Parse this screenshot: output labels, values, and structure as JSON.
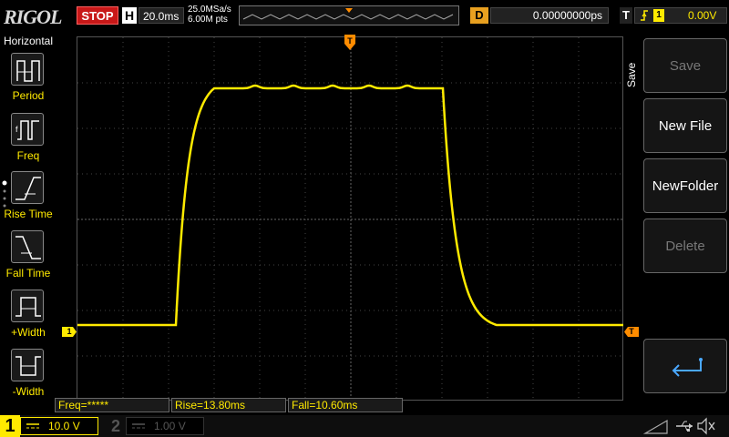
{
  "header": {
    "brand": "RIGOL",
    "run_state": "STOP",
    "horizontal_label": "H",
    "timebase": "20.0ms",
    "sample_rate": "25.0MSa/s",
    "memory_depth": "6.00M pts",
    "delay_label": "D",
    "delay_value": "0.00000000ps",
    "trigger_label": "T",
    "trigger_source": "1",
    "trigger_level": "0.00V"
  },
  "left_menu": {
    "title": "Horizontal",
    "items": [
      {
        "label": "Period",
        "icon": "period-icon"
      },
      {
        "label": "Freq",
        "icon": "freq-icon"
      },
      {
        "label": "Rise Time",
        "icon": "rise-time-icon"
      },
      {
        "label": "Fall Time",
        "icon": "fall-time-icon"
      },
      {
        "label": "+Width",
        "icon": "pos-width-icon"
      },
      {
        "label": "-Width",
        "icon": "neg-width-icon"
      }
    ]
  },
  "right_menu": {
    "title": "Save",
    "buttons": [
      {
        "label": "Save",
        "enabled": false
      },
      {
        "label": "New File",
        "enabled": true
      },
      {
        "label": "NewFolder",
        "enabled": true
      },
      {
        "label": "Delete",
        "enabled": false
      }
    ],
    "back_icon": "return-arrow-icon"
  },
  "measurements": {
    "freq": "Freq=*****",
    "rise": "Rise=13.80ms",
    "fall": "Fall=10.60ms"
  },
  "channels": {
    "ch1_num": "1",
    "ch1_scale": "10.0 V",
    "ch2_num": "2",
    "ch2_scale": "1.00 V"
  },
  "markers": {
    "ch1_ground": "1",
    "trigger_pos": "T"
  },
  "colors": {
    "ch1": "#ffea00",
    "trigger": "#ff8c00",
    "stop": "#c81818"
  }
}
